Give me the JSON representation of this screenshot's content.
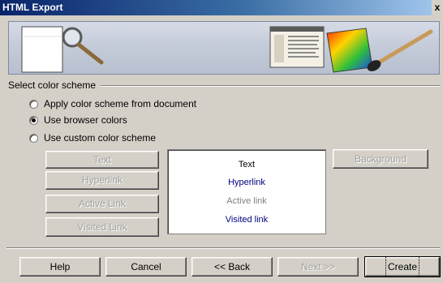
{
  "window": {
    "title": "HTML Export",
    "close_glyph": "x"
  },
  "group": {
    "label": "Select color scheme"
  },
  "radios": [
    {
      "label": "Apply color scheme from document",
      "checked": false
    },
    {
      "label": "Use browser colors",
      "checked": true
    },
    {
      "label": "Use custom color scheme",
      "checked": false
    }
  ],
  "color_buttons": {
    "text": "Text",
    "hyperlink": "Hyperlink",
    "active_link": "Active Link",
    "visited_link": "Visited Link",
    "background": "Background"
  },
  "preview": {
    "text": "Text",
    "hyperlink": "Hyperlink",
    "active_link": "Active link",
    "visited_link": "Visited link",
    "colors": {
      "text": "#000000",
      "hyperlink": "#000080",
      "active": "#808080",
      "visited": "#000080"
    }
  },
  "footer": {
    "help": "Help",
    "cancel": "Cancel",
    "back": "<< Back",
    "next": "Next >>",
    "create": "Create"
  },
  "icons": [
    "document-icon",
    "magnifier-icon",
    "palette-icon",
    "brush-icon"
  ]
}
